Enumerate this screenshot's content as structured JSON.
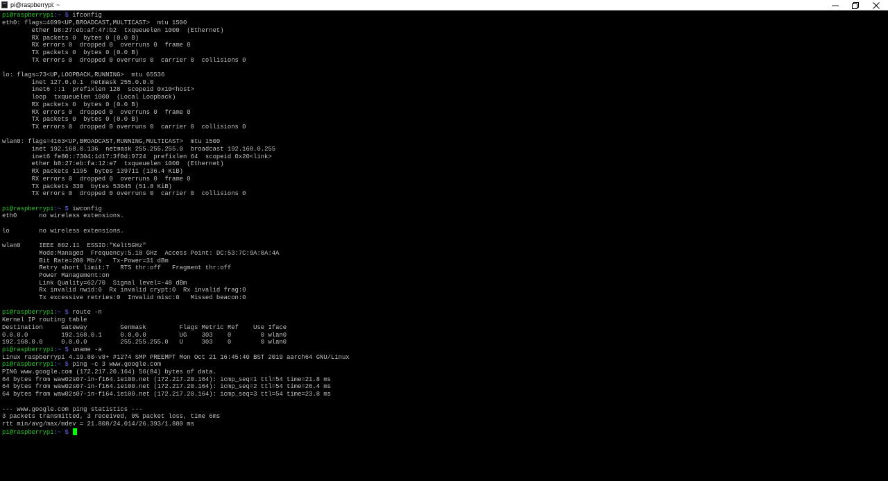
{
  "window": {
    "title": "pi@raspberrypi: ~",
    "minimize_icon": "minimize-icon",
    "maximize_icon": "restore-icon",
    "close_icon": "close-icon"
  },
  "terminal": {
    "prompt_user": "pi@raspberrypi",
    "prompt_path": ":~ $",
    "lines": [
      {
        "type": "prompt",
        "cmd": " ifconfig"
      },
      {
        "type": "out",
        "text": "eth0: flags=4099<UP,BROADCAST,MULTICAST>  mtu 1500"
      },
      {
        "type": "out",
        "text": "        ether b8:27:eb:af:47:b2  txqueuelen 1000  (Ethernet)"
      },
      {
        "type": "out",
        "text": "        RX packets 0  bytes 0 (0.0 B)"
      },
      {
        "type": "out",
        "text": "        RX errors 0  dropped 0  overruns 0  frame 0"
      },
      {
        "type": "out",
        "text": "        TX packets 0  bytes 0 (0.0 B)"
      },
      {
        "type": "out",
        "text": "        TX errors 0  dropped 0 overruns 0  carrier 0  collisions 0"
      },
      {
        "type": "out",
        "text": ""
      },
      {
        "type": "out",
        "text": "lo: flags=73<UP,LOOPBACK,RUNNING>  mtu 65536"
      },
      {
        "type": "out",
        "text": "        inet 127.0.0.1  netmask 255.0.0.0"
      },
      {
        "type": "out",
        "text": "        inet6 ::1  prefixlen 128  scopeid 0x10<host>"
      },
      {
        "type": "out",
        "text": "        loop  txqueuelen 1000  (Local Loopback)"
      },
      {
        "type": "out",
        "text": "        RX packets 0  bytes 0 (0.0 B)"
      },
      {
        "type": "out",
        "text": "        RX errors 0  dropped 0  overruns 0  frame 0"
      },
      {
        "type": "out",
        "text": "        TX packets 0  bytes 0 (0.0 B)"
      },
      {
        "type": "out",
        "text": "        TX errors 0  dropped 0 overruns 0  carrier 0  collisions 0"
      },
      {
        "type": "out",
        "text": ""
      },
      {
        "type": "out",
        "text": "wlan0: flags=4163<UP,BROADCAST,RUNNING,MULTICAST>  mtu 1500"
      },
      {
        "type": "out",
        "text": "        inet 192.168.0.136  netmask 255.255.255.0  broadcast 192.168.0.255"
      },
      {
        "type": "out",
        "text": "        inet6 fe80::7304:1d17:3f0d:9724  prefixlen 64  scopeid 0x20<link>"
      },
      {
        "type": "out",
        "text": "        ether b8:27:eb:fa:12:e7  txqueuelen 1000  (Ethernet)"
      },
      {
        "type": "out",
        "text": "        RX packets 1195  bytes 139711 (136.4 KiB)"
      },
      {
        "type": "out",
        "text": "        RX errors 0  dropped 0  overruns 0  frame 0"
      },
      {
        "type": "out",
        "text": "        TX packets 330  bytes 53045 (51.8 KiB)"
      },
      {
        "type": "out",
        "text": "        TX errors 0  dropped 0 overruns 0  carrier 0  collisions 0"
      },
      {
        "type": "out",
        "text": ""
      },
      {
        "type": "prompt",
        "cmd": " iwconfig"
      },
      {
        "type": "out",
        "text": "eth0      no wireless extensions."
      },
      {
        "type": "out",
        "text": ""
      },
      {
        "type": "out",
        "text": "lo        no wireless extensions."
      },
      {
        "type": "out",
        "text": ""
      },
      {
        "type": "out",
        "text": "wlan0     IEEE 802.11  ESSID:\"Kelt5GHz\""
      },
      {
        "type": "out",
        "text": "          Mode:Managed  Frequency:5.18 GHz  Access Point: DC:53:7C:9A:0A:4A"
      },
      {
        "type": "out",
        "text": "          Bit Rate=200 Mb/s   Tx-Power=31 dBm"
      },
      {
        "type": "out",
        "text": "          Retry short limit:7   RTS thr:off   Fragment thr:off"
      },
      {
        "type": "out",
        "text": "          Power Management:on"
      },
      {
        "type": "out",
        "text": "          Link Quality=62/70  Signal level=-48 dBm"
      },
      {
        "type": "out",
        "text": "          Rx invalid nwid:0  Rx invalid crypt:0  Rx invalid frag:0"
      },
      {
        "type": "out",
        "text": "          Tx excessive retries:0  Invalid misc:0   Missed beacon:0"
      },
      {
        "type": "out",
        "text": ""
      },
      {
        "type": "prompt",
        "cmd": " route -n"
      },
      {
        "type": "out",
        "text": "Kernel IP routing table"
      },
      {
        "type": "out",
        "text": "Destination     Gateway         Genmask         Flags Metric Ref    Use Iface"
      },
      {
        "type": "out",
        "text": "0.0.0.0         192.168.0.1     0.0.0.0         UG    303    0        0 wlan0"
      },
      {
        "type": "out",
        "text": "192.168.0.0     0.0.0.0         255.255.255.0   U     303    0        0 wlan0"
      },
      {
        "type": "prompt",
        "cmd": " uname -a"
      },
      {
        "type": "out",
        "text": "Linux raspberrypi 4.19.80-v8+ #1274 SMP PREEMPT Mon Oct 21 16:45:40 BST 2019 aarch64 GNU/Linux"
      },
      {
        "type": "prompt",
        "cmd": " ping -c 3 www.google.com"
      },
      {
        "type": "out",
        "text": "PING www.google.com (172.217.20.164) 56(84) bytes of data."
      },
      {
        "type": "out",
        "text": "64 bytes from waw02s07-in-f164.1e100.net (172.217.20.164): icmp_seq=1 ttl=54 time=21.8 ms"
      },
      {
        "type": "out",
        "text": "64 bytes from waw02s07-in-f164.1e100.net (172.217.20.164): icmp_seq=2 ttl=54 time=26.4 ms"
      },
      {
        "type": "out",
        "text": "64 bytes from waw02s07-in-f164.1e100.net (172.217.20.164): icmp_seq=3 ttl=54 time=23.8 ms"
      },
      {
        "type": "out",
        "text": ""
      },
      {
        "type": "out",
        "text": "--- www.google.com ping statistics ---"
      },
      {
        "type": "out",
        "text": "3 packets transmitted, 3 received, 0% packet loss, time 6ms"
      },
      {
        "type": "out",
        "text": "rtt min/avg/max/mdev = 21.808/24.014/26.393/1.880 ms"
      },
      {
        "type": "prompt",
        "cmd": " ",
        "cursor": true
      }
    ]
  },
  "colors": {
    "background": "#000000",
    "text": "#c0c0c0",
    "prompt_user": "#2ccb2c",
    "prompt_path": "#6a6ae8",
    "cursor": "#00ff00"
  }
}
